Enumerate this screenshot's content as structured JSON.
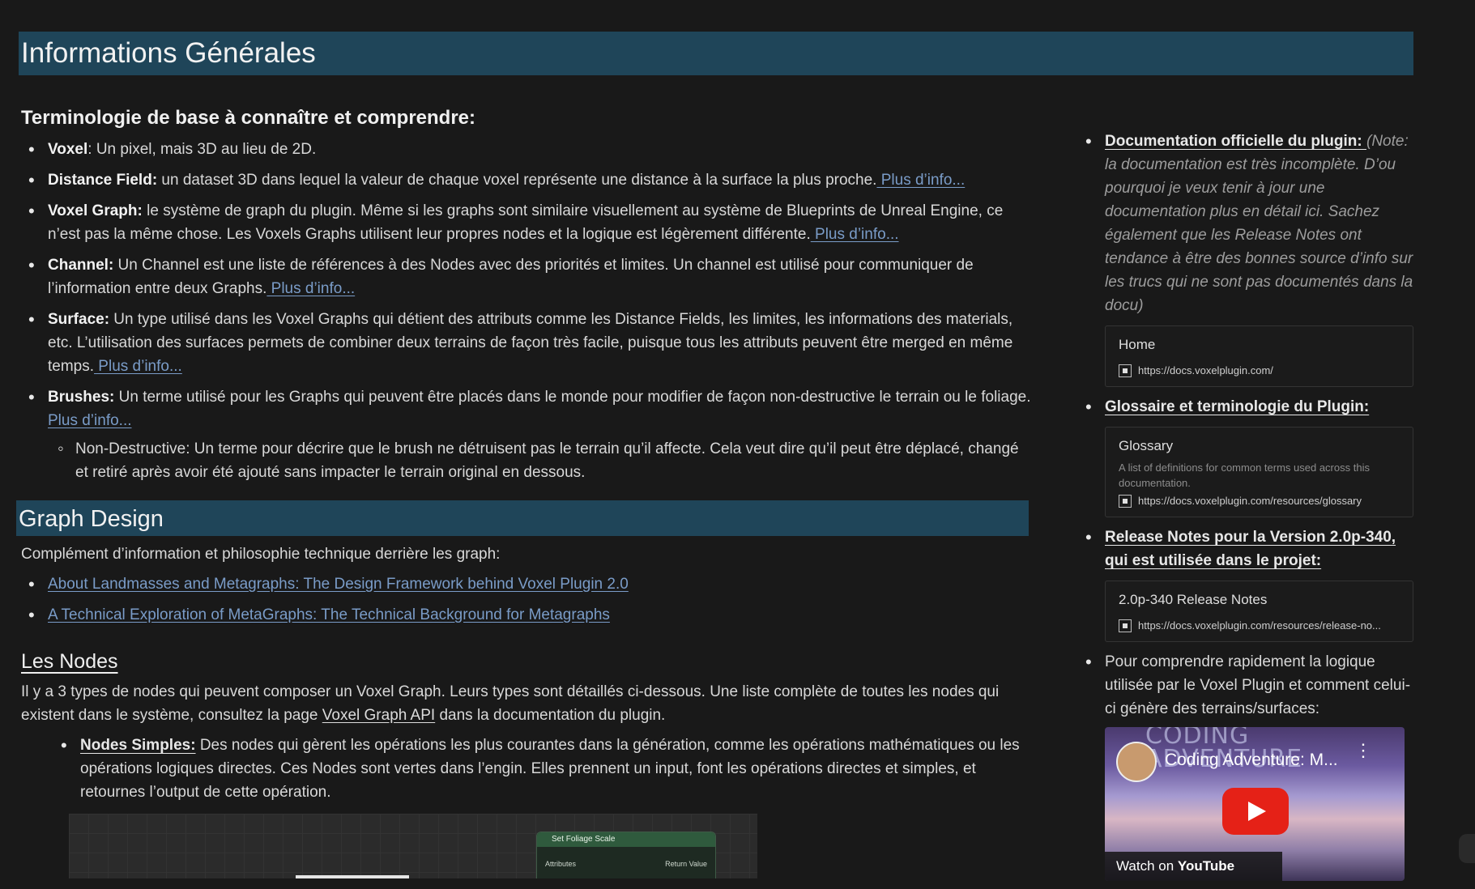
{
  "header": {
    "title": "Informations Générales"
  },
  "terminology": {
    "heading": "Terminologie de base à connaître et comprendre:",
    "items": [
      {
        "term": "Voxel",
        "text": ": Un pixel, mais 3D au lieu de 2D.",
        "link": ""
      },
      {
        "term": "Distance Field:",
        "text": " un dataset 3D dans lequel la valeur de chaque voxel représente une distance à la surface la plus proche.",
        "link": " Plus d’info..."
      },
      {
        "term": "Voxel Graph:",
        "text": " le système de graph du plugin. Même si les graphs sont similaire visuellement au système de Blueprints de Unreal Engine, ce n’est pas la même chose. Les Voxels Graphs utilisent leur propres nodes et la logique est légèrement différente.",
        "link": " Plus d’info..."
      },
      {
        "term": "Channel:",
        "text": " Un Channel est une liste de références à des Nodes avec des priorités et limites. Un channel est utilisé pour communiquer de l’information entre deux Graphs.",
        "link": " Plus d’info..."
      },
      {
        "term": "Surface:",
        "text": " Un type utilisé dans les Voxel Graphs qui détient des attributs comme les Distance Fields, les limites, les informations des materials, etc. L’utilisation des surfaces permets de combiner deux terrains de façon très facile, puisque tous les attributs peuvent être merged en même temps.",
        "link": " Plus d’info..."
      },
      {
        "term": "Brushes:",
        "text": " Un terme utilisé pour les Graphs qui peuvent être placés dans le monde pour modifier de façon non-destructive le terrain ou le foliage.",
        "link": " Plus d’info..."
      }
    ],
    "subitem": "Non-Destructive: Un terme pour décrire que le brush ne détruisent pas le terrain qu’il affecte. Cela veut dire qu’il peut être déplacé, changé et retiré après avoir été ajouté sans impacter le terrain original en dessous."
  },
  "graph_design": {
    "title": "Graph Design",
    "intro": "Complément d’information et philosophie technique derrière les graph:",
    "links": [
      "About Landmasses and Metagraphs: The Design Framework behind Voxel Plugin 2.0",
      "A Technical Exploration of MetaGraphs: The Technical Background for Metagraphs"
    ]
  },
  "nodes": {
    "title": "Les Nodes",
    "intro_before": "Il y a 3 types de nodes qui peuvent composer un Voxel Graph. Leurs types sont détaillés ci-dessous. Une liste complète de toutes les nodes qui existent dans le système, consultez la page ",
    "intro_link": "Voxel Graph API",
    "intro_after": " dans la documentation du plugin.",
    "simple_term": "Nodes Simples:",
    "simple_text": " Des nodes qui gèrent les opérations les plus courantes dans la génération, comme les opérations mathématiques ou les opérations logiques directes. Ces Nodes sont vertes dans l’engin. Elles prennent un input, font les opérations directes et simples, et retournes l’output de cette opération.",
    "graph_node_title": "Set Foliage Scale",
    "graph_node_in": "Attributes",
    "graph_node_out": "Return Value"
  },
  "sidebar": {
    "doc_link": "Documentation officielle du plugin: ",
    "doc_note": "(Note: la documentation est très incomplète. D’ou pourquoi je veux tenir à jour une documentation plus en détail ici. Sachez également que les Release Notes ont tendance à être des bonnes source d’info sur les trucs qui ne sont pas documentés dans la docu)",
    "card_home": {
      "title": "Home",
      "url": "https://docs.voxelplugin.com/"
    },
    "glossary_link": "Glossaire et terminologie du Plugin: ",
    "card_glossary": {
      "title": "Glossary",
      "desc": "A list of definitions for common terms used across this documentation.",
      "url": "https://docs.voxelplugin.com/resources/glossary"
    },
    "release_link": "Release Notes pour la Version 2.0p-340, qui est utilisée dans le projet:",
    "card_release": {
      "title": "2.0p-340 Release Notes",
      "url": "https://docs.voxelplugin.com/resources/release-no..."
    },
    "logic_text": "Pour comprendre rapidement la logique utilisée par le Voxel Plugin et comment celui-ci génère des terrains/surfaces:",
    "video": {
      "brand": "CODING ADVENTURE",
      "title": "Coding Adventure: M...",
      "watch_prefix": "Watch on",
      "watch_brand": "YouTube"
    }
  }
}
